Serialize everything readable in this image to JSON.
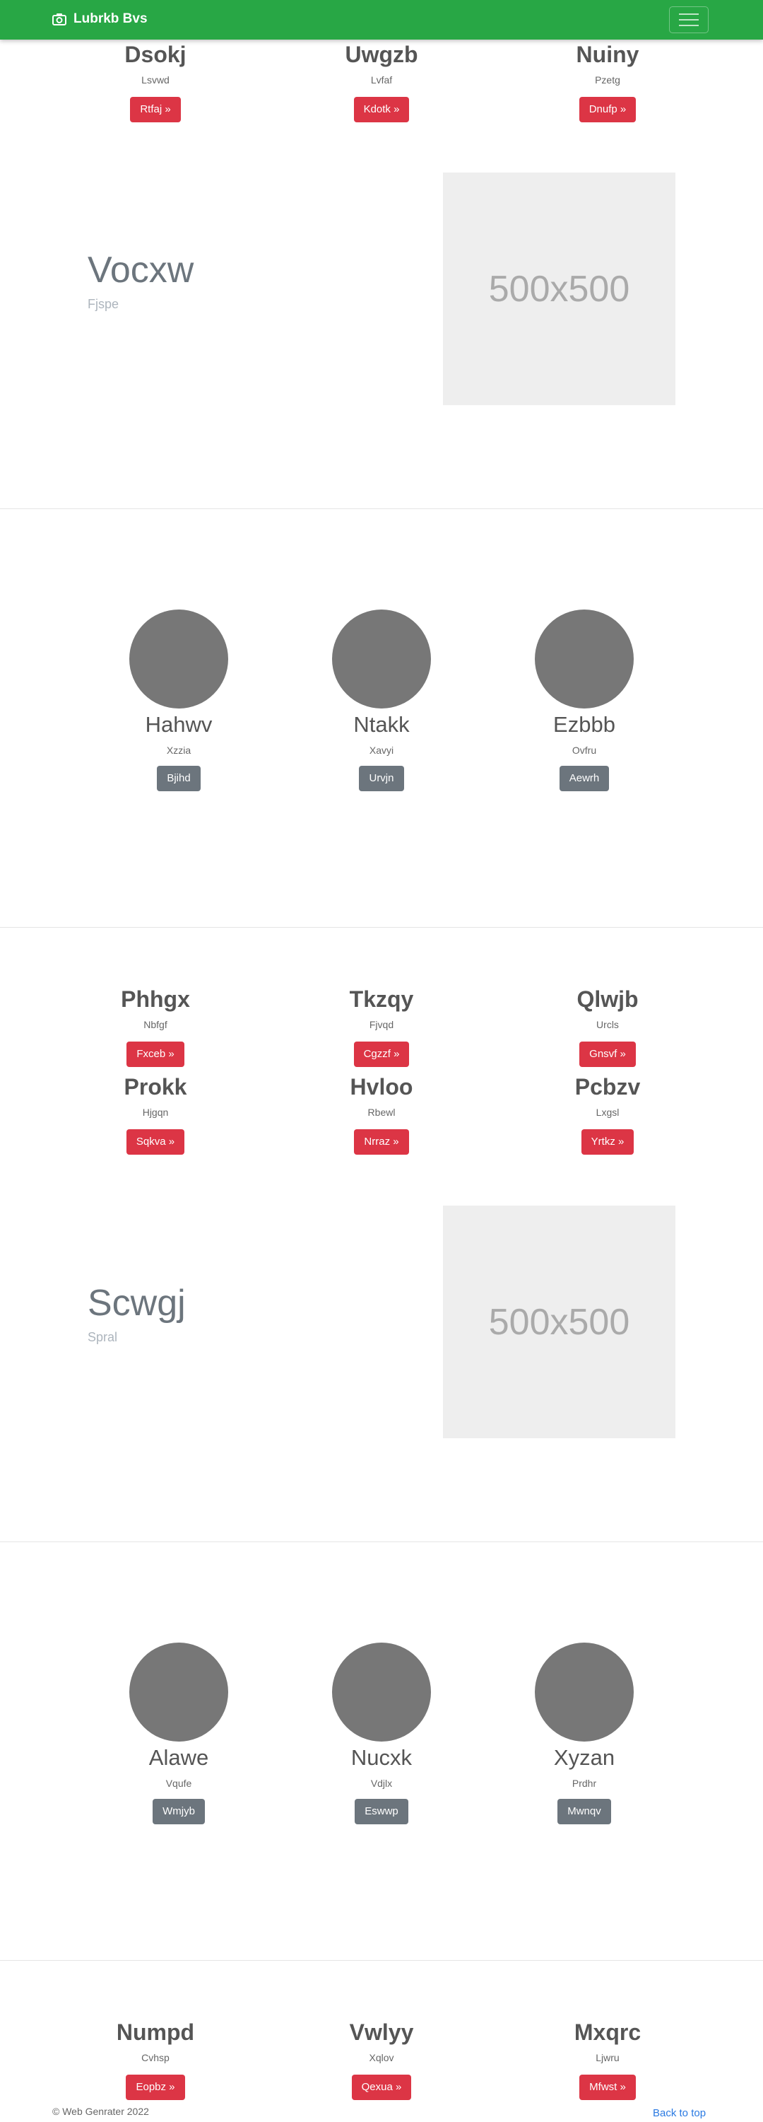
{
  "navbar": {
    "brand": "Lubrkb Bvs"
  },
  "features_1": [
    {
      "title": "Dsokj",
      "sub": "Lsvwd",
      "button": "Rtfaj »"
    },
    {
      "title": "Uwgzb",
      "sub": "Lvfaf",
      "button": "Kdotk »"
    },
    {
      "title": "Nuiny",
      "sub": "Pzetg",
      "button": "Dnufp »"
    }
  ],
  "hero_1": {
    "title": "Vocxw",
    "subtitle": "Fjspe",
    "placeholder": "500x500"
  },
  "team_1": [
    {
      "name": "Hahwv",
      "sub": "Xzzia",
      "button": "Bjihd"
    },
    {
      "name": "Ntakk",
      "sub": "Xavyi",
      "button": "Urvjn"
    },
    {
      "name": "Ezbbb",
      "sub": "Ovfru",
      "button": "Aewrh"
    }
  ],
  "features_2": [
    {
      "title": "Phhgx",
      "sub": "Nbfgf",
      "button": "Fxceb »"
    },
    {
      "title": "Tkzqy",
      "sub": "Fjvqd",
      "button": "Cgzzf »"
    },
    {
      "title": "Qlwjb",
      "sub": "Urcls",
      "button": "Gnsvf »"
    },
    {
      "title": "Prokk",
      "sub": "Hjgqn",
      "button": "Sqkva »"
    },
    {
      "title": "Hvloo",
      "sub": "Rbewl",
      "button": "Nrraz »"
    },
    {
      "title": "Pcbzv",
      "sub": "Lxgsl",
      "button": "Yrtkz »"
    }
  ],
  "hero_2": {
    "title": "Scwgj",
    "subtitle": "Spral",
    "placeholder": "500x500"
  },
  "team_2": [
    {
      "name": "Alawe",
      "sub": "Vqufe",
      "button": "Wmjyb"
    },
    {
      "name": "Nucxk",
      "sub": "Vdjlx",
      "button": "Eswwp"
    },
    {
      "name": "Xyzan",
      "sub": "Prdhr",
      "button": "Mwnqv"
    }
  ],
  "features_3": [
    {
      "title": "Numpd",
      "sub": "Cvhsp",
      "button": "Eopbz »"
    },
    {
      "title": "Vwlyy",
      "sub": "Xqlov",
      "button": "Qexua »"
    },
    {
      "title": "Mxqrc",
      "sub": "Ljwru",
      "button": "Mfwst »"
    }
  ],
  "footer": {
    "copyright": "© Web Genrater 2022",
    "back_to_top": "Back to top"
  }
}
